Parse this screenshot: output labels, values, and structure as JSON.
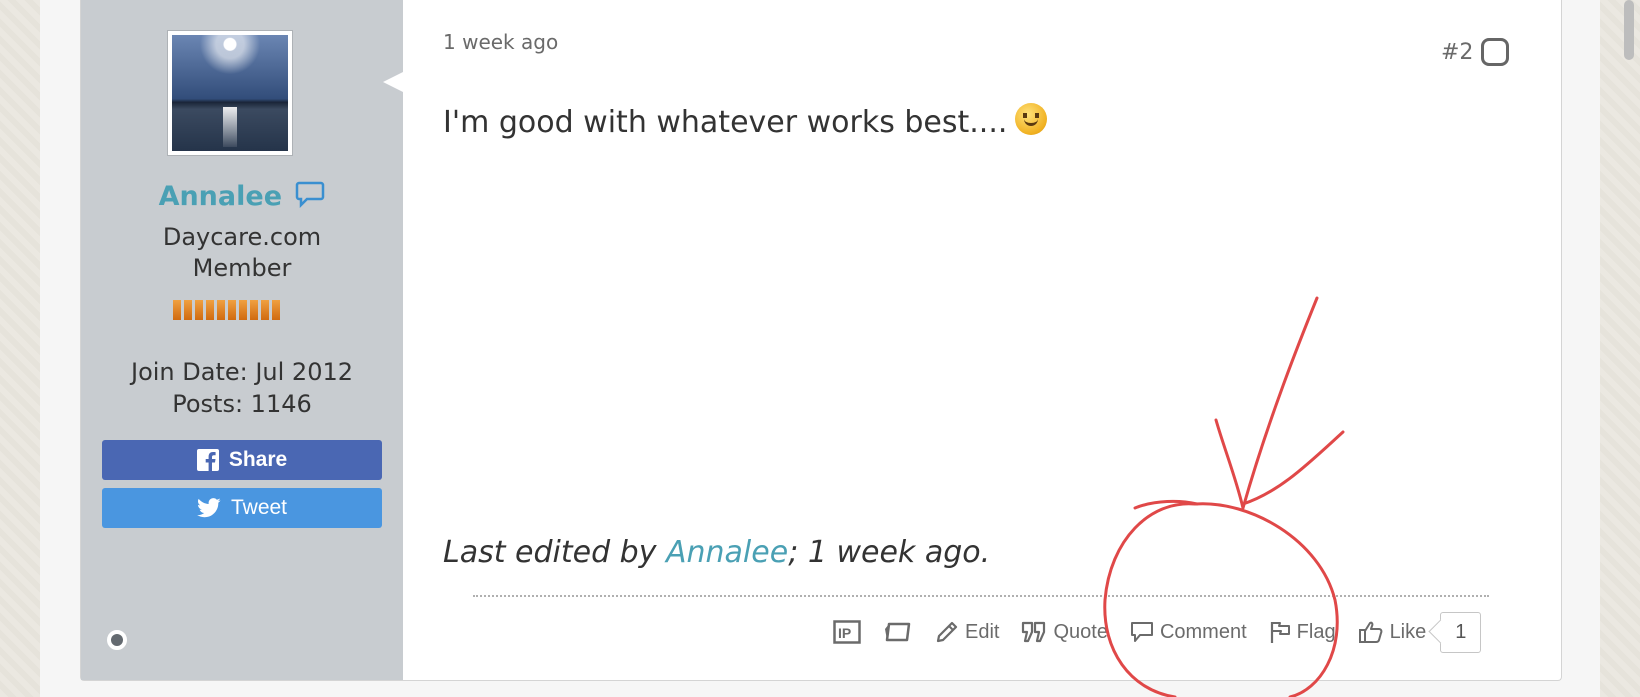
{
  "colors": {
    "accent_link": "#4aa0b4",
    "share_button": "#4a67b3",
    "tweet_button": "#4a96e0",
    "user_panel_bg": "#c8ccd0",
    "annotation_red": "#e04848"
  },
  "user": {
    "avatar_icon": "avatar-image",
    "name": "Annalee",
    "pm_icon": "speech-bubble-icon",
    "title_line1": "Daycare.com",
    "title_line2": "Member",
    "reputation_segments": 10,
    "join_date": "Join Date: Jul 2012",
    "posts": "Posts: 1146",
    "share_label": "Share",
    "tweet_label": "Tweet",
    "online_status_icon": "status-dot-icon"
  },
  "post": {
    "date": "1 week ago",
    "number": "#2",
    "content": "I'm good with whatever works best....",
    "emoticon": "smiley-icon",
    "edited_prefix": "Last edited by ",
    "edited_user": "Annalee",
    "edited_suffix": "; 1 week ago."
  },
  "controls": {
    "ip_icon": "ip-icon",
    "eraser_icon": "eraser-icon",
    "edit_label": "Edit",
    "quote_label": "Quote",
    "comment_label": "Comment",
    "flag_label": "Flag",
    "like_label": "Like",
    "like_count": "1"
  },
  "annotation": {
    "type": "hand-drawn arrow and circle",
    "target": "Comment / Flag controls"
  }
}
